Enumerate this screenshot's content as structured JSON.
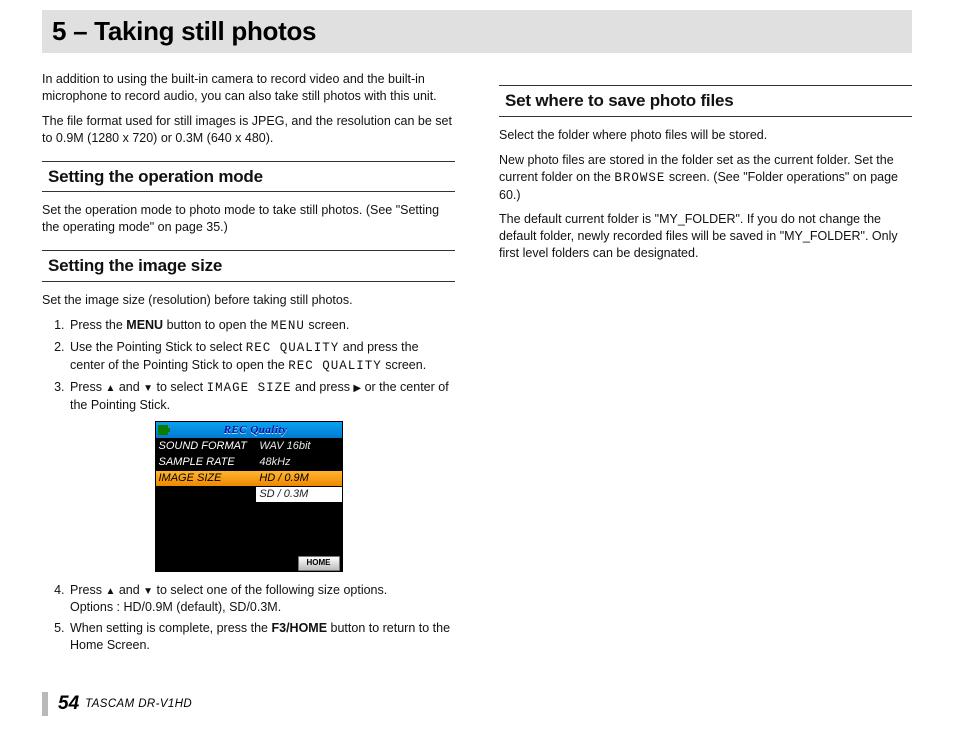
{
  "chapter": {
    "title": "5 – Taking still photos"
  },
  "intro": {
    "p1": "In addition to using the built-in camera to record video and the built-in microphone to record audio, you can also take still photos with this unit.",
    "p2": "The file format used for still images is JPEG, and the resolution can be set to 0.9M (1280 x 720) or 0.3M (640 x 480)."
  },
  "section_op_mode": {
    "heading": "Setting the operation mode",
    "p1": "Set the operation mode to photo mode to take still photos. (See \"Setting the operating mode\" on page 35.)"
  },
  "section_img_size": {
    "heading": "Setting the image size",
    "p1": "Set the image size (resolution) before taking still photos.",
    "step1_a": "Press the ",
    "step1_bold": "MENU",
    "step1_b": " button to open the ",
    "step1_lcd": "MENU",
    "step1_c": " screen.",
    "step2_a": "Use the Pointing Stick to select ",
    "step2_lcd1": "REC QUALITY",
    "step2_b": " and press the center of the Pointing Stick to open the ",
    "step2_lcd2": "REC QUALITY",
    "step2_c": " screen.",
    "step3_a": "Press ",
    "step3_up": "▲",
    "step3_b": " and ",
    "step3_dn": "▼",
    "step3_c": " to select ",
    "step3_lcd": "IMAGE SIZE",
    "step3_d": " and press ",
    "step3_rt": "▶",
    "step3_e": " or the center of the Pointing Stick.",
    "step4_a": "Press ",
    "step4_up": "▲",
    "step4_b": " and ",
    "step4_dn": "▼",
    "step4_c": " to select one of the following size options.",
    "step4_opts": "Options : HD/0.9M (default), SD/0.3M.",
    "step5_a": "When setting is complete, press the ",
    "step5_bold": "F3/HOME",
    "step5_b": " button to return to the Home Screen."
  },
  "screen": {
    "title": "REC Quality",
    "row1_label": "SOUND FORMAT",
    "row1_value": "WAV 16bit",
    "row2_label": "SAMPLE RATE",
    "row2_value": "48kHz",
    "row3_label": "IMAGE SIZE",
    "row3_value": "HD / 0.9M",
    "row4_value": "SD / 0.3M",
    "home": "HOME"
  },
  "section_save": {
    "heading": "Set where to save photo files",
    "p1": "Select the folder where photo files will be stored.",
    "p2_a": "New photo files are stored in the folder set as the current folder. Set the current folder on the ",
    "p2_lcd": "BROWSE",
    "p2_b": " screen. (See \"Folder operations\" on page 60.)",
    "p3": "The default current folder is \"MY_FOLDER\". If you do not change the default folder, newly recorded files will be saved in \"MY_FOLDER\". Only first level folders can be designated."
  },
  "footer": {
    "page": "54",
    "product": "TASCAM  DR-V1HD"
  }
}
